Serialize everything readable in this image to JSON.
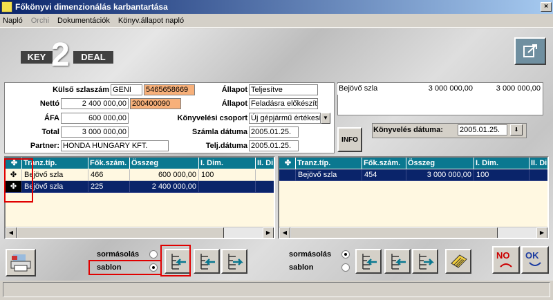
{
  "window": {
    "title": "Főkönyvi dimenzionálás karbantartása"
  },
  "menu": [
    "Napló",
    "Orchi",
    "Dokumentációk",
    "Könyv.állapot napló"
  ],
  "logo": {
    "left": "KEY",
    "middle": "2",
    "right": "DEAL"
  },
  "form": {
    "kulso_szlaszam_label": "Külső szlaszám",
    "kulso_szlaszam_1": "GENI",
    "kulso_szlaszam_2": "5465658669",
    "netto_label": "Nettó",
    "netto_value": "2 400 000,00",
    "netto_code": "200400090",
    "afa_label": "ÁFA",
    "afa_value": "600 000,00",
    "total_label": "Total",
    "total_value": "3 000 000,00",
    "partner_label": "Partner:",
    "partner_value": "HONDA HUNGARY KFT.",
    "allapot1_label": "Állapot",
    "allapot1_value": "Teljesítve",
    "allapot2_label": "Állapot",
    "allapot2_value": "Feladásra előkészítv",
    "konyv_csoport_label": "Könyvelési csoport",
    "konyv_csoport_value": "Új gépjármű értékesí",
    "szamla_datum_label": "Számla dátuma",
    "szamla_datum_value": "2005.01.25.",
    "telj_datum_label": "Telj.dátuma",
    "telj_datum_value": "2005.01.25."
  },
  "summary": {
    "name": "Bejövő szla",
    "v1": "3 000 000,00",
    "v2": "3 000 000,00"
  },
  "info_label": "INFO",
  "konyveles_datum_label": "Könyvelés dátuma:",
  "konyveles_datum_value": "2005.01.25.",
  "left_grid": {
    "headers": [
      "Tranz.típ.",
      "Fők.szám.",
      "Összeg",
      "I. Dim.",
      "II. Di"
    ],
    "rows": [
      {
        "type": "Bejövő szla",
        "account": "466",
        "amount": "600 000,00",
        "dim1": "100",
        "dim2": ""
      },
      {
        "type": "Bejövő szla",
        "account": "225",
        "amount": "2 400 000,00",
        "dim1": "",
        "dim2": ""
      }
    ]
  },
  "right_grid": {
    "headers": [
      "Tranz.típ.",
      "Fők.szám.",
      "Összeg",
      "I. Dim.",
      "II. Di"
    ],
    "rows": [
      {
        "type": "Bejövő szla",
        "account": "454",
        "amount": "3 000 000,00",
        "dim1": "100",
        "dim2": ""
      }
    ]
  },
  "radio_left": {
    "opt1": "sormásolás",
    "opt2": "sablon",
    "selected": "sablon"
  },
  "radio_right": {
    "opt1": "sormásolás",
    "opt2": "sablon",
    "selected": "sormásolás"
  },
  "no_label": "NO",
  "ok_label": "OK"
}
